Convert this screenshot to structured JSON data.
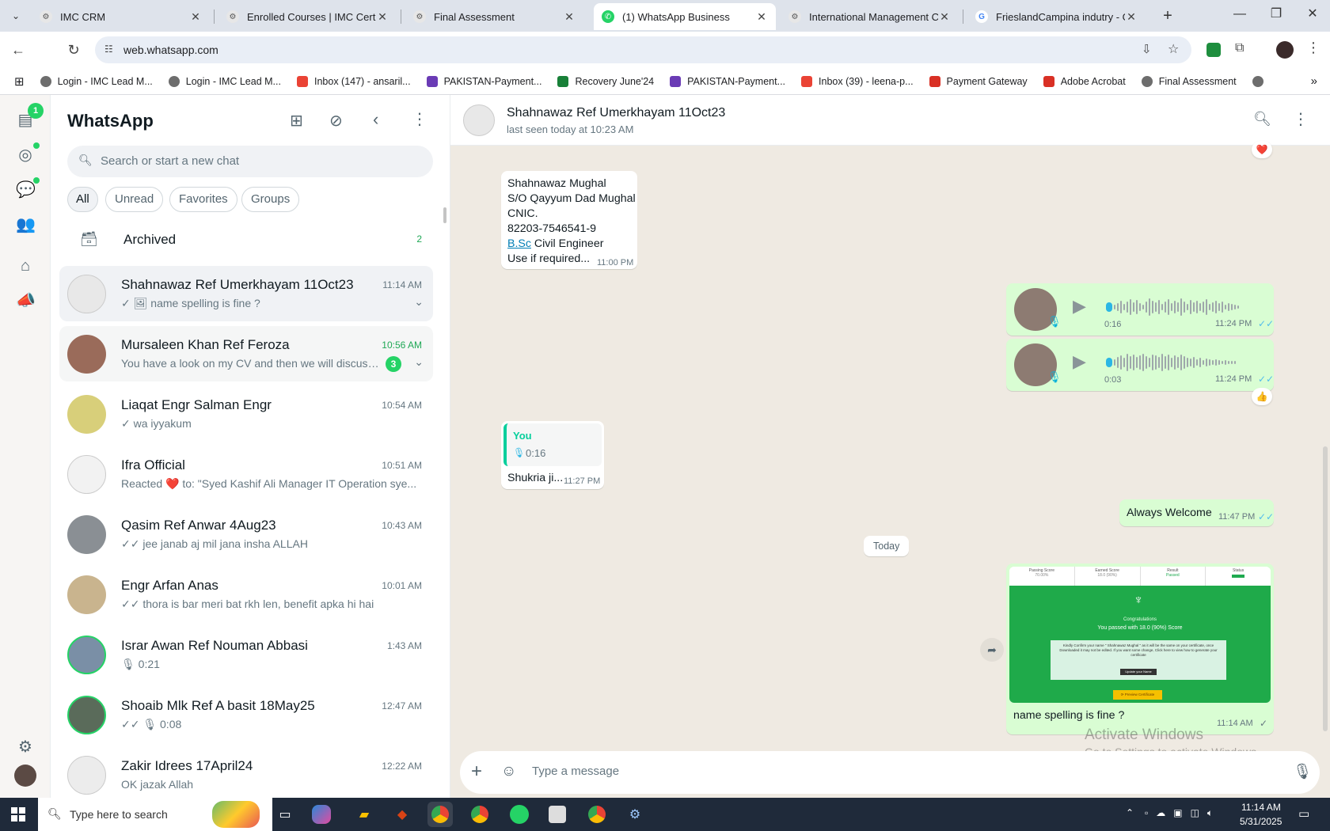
{
  "browser": {
    "tabs": [
      {
        "label": "IMC CRM",
        "active": false
      },
      {
        "label": "Enrolled Courses | IMC Certifica",
        "active": false
      },
      {
        "label": "Final Assessment",
        "active": false
      },
      {
        "label": "(1) WhatsApp Business",
        "active": true
      },
      {
        "label": "International Management Con",
        "active": false
      },
      {
        "label": "FrieslandCampina indutry - Goo",
        "active": false
      }
    ],
    "url": "web.whatsapp.com",
    "bookmarks": [
      {
        "label": "Login - IMC Lead M...",
        "color": "#6d6d6d"
      },
      {
        "label": "Login - IMC Lead M...",
        "color": "#6d6d6d"
      },
      {
        "label": "Inbox (147) - ansaril...",
        "color": "#ea4335"
      },
      {
        "label": "PAKISTAN-Payment...",
        "color": "#6a3bb5"
      },
      {
        "label": "Recovery June'24",
        "color": "#188038"
      },
      {
        "label": "PAKISTAN-Payment...",
        "color": "#6a3bb5"
      },
      {
        "label": "Inbox (39) - leena-p...",
        "color": "#ea4335"
      },
      {
        "label": "Payment Gateway",
        "color": "#d93025"
      },
      {
        "label": "Adobe Acrobat",
        "color": "#d93025"
      },
      {
        "label": "Final Assessment",
        "color": "#6d6d6d"
      }
    ]
  },
  "sidebar": {
    "title": "WhatsApp",
    "chats_badge": "1",
    "search_placeholder": "Search or start a new chat",
    "filters": [
      "All",
      "Unread",
      "Favorites",
      "Groups"
    ],
    "archived_label": "Archived",
    "archived_count": "2",
    "chats": [
      {
        "name": "Shahnawaz Ref Umerkhayam 11Oct23",
        "time": "11:14 AM",
        "preview": "✓ 🖼 name spelling is fine ?",
        "unread": "",
        "state": "selected",
        "ring": false,
        "avatar_color": "#e8e8e8"
      },
      {
        "name": "Mursaleen Khan Ref Feroza",
        "time": "10:56 AM",
        "preview": "You have a look on my CV and then we will discuss ...",
        "unread": "3",
        "state": "hover",
        "ring": false,
        "avatar_color": "#9a6b5a"
      },
      {
        "name": "Liaqat Engr Salman Engr",
        "time": "10:54 AM",
        "preview": "✓ wa iyyakum",
        "unread": "",
        "state": "",
        "ring": false,
        "avatar_color": "#d8cf7a"
      },
      {
        "name": "Ifra Official",
        "time": "10:51 AM",
        "preview": "Reacted ❤️ to: \"Syed Kashif Ali  Manager IT Operation  sye...",
        "unread": "",
        "state": "",
        "ring": false,
        "avatar_color": "#f2f2f2"
      },
      {
        "name": "Qasim Ref Anwar 4Aug23",
        "time": "10:43 AM",
        "preview": "✓✓ jee janab aj mil  jana insha ALLAH",
        "unread": "",
        "state": "",
        "ring": false,
        "avatar_color": "#8a8f94"
      },
      {
        "name": "Engr Arfan Anas",
        "time": "10:01 AM",
        "preview": "✓✓ thora is bar meri bat rkh len, benefit apka hi hai",
        "unread": "",
        "state": "",
        "ring": false,
        "avatar_color": "#c9b48e"
      },
      {
        "name": "Israr Awan Ref Nouman Abbasi",
        "time": "1:43 AM",
        "preview": "🎙 0:21",
        "unread": "",
        "state": "",
        "ring": true,
        "avatar_color": "#7a8fa6"
      },
      {
        "name": "Shoaib Mlk Ref A basit 18May25",
        "time": "12:47 AM",
        "preview": "✓✓ 🎙 0:08",
        "unread": "",
        "state": "",
        "ring": true,
        "avatar_color": "#5a6b5a"
      },
      {
        "name": "Zakir Idrees 17April24",
        "time": "12:22 AM",
        "preview": "OK jazak Allah",
        "unread": "",
        "state": "",
        "ring": false,
        "avatar_color": "#ececec"
      }
    ]
  },
  "conversation": {
    "contact_name": "Shahnawaz Ref Umerkhayam 11Oct23",
    "status": "last seen today at 10:23 AM",
    "msg1": {
      "lines": [
        "Shahnawaz Mughal",
        "S/O Qayyum Dad Mughal",
        "CNIC.",
        "82203-7546541-9"
      ],
      "link_word": "B.Sc",
      "line5_rest": " Civil Engineer",
      "line6": "Use if required...",
      "time": "11:00 PM"
    },
    "voice1": {
      "duration": "0:16",
      "time": "11:24 PM"
    },
    "voice2": {
      "duration": "0:03",
      "time": "11:24 PM"
    },
    "reaction_heart": "❤️",
    "reaction_thumb": "👍",
    "reply": {
      "quoted_author": "You",
      "quoted_duration": "0:16",
      "text": "Shukria ji...",
      "time": "11:27 PM"
    },
    "out_text": {
      "text": "Always Welcome",
      "time": "11:47 PM"
    },
    "date_divider": "Today",
    "image_msg": {
      "caption": "name spelling is fine ?",
      "time": "11:14 AM",
      "img_headers": [
        "Passing Score",
        "Earned Score",
        "Result",
        "Status"
      ],
      "img_values": [
        "70.00%",
        "18.0 (90%)",
        "Passed",
        ""
      ],
      "img_congrats": "Congratulations",
      "img_score": "You passed with 18.0 (90%) Score",
      "img_notice": "Kindly Confirm your name \" Shahnawaz Mughal \" as it will be the same on your certificate, once Downloaded it may not be edited. If you want some change, Click here to view how to generate your certificate",
      "img_update_btn": "Update your Name",
      "img_preview_btn": "⟳ Preview Certificate"
    },
    "composer_placeholder": "Type a message",
    "watermark_title": "Activate Windows",
    "watermark_sub": "Go to Settings to activate Windows."
  },
  "taskbar": {
    "search_placeholder": "Type here to search",
    "time": "11:14 AM",
    "date": "5/31/2025"
  }
}
